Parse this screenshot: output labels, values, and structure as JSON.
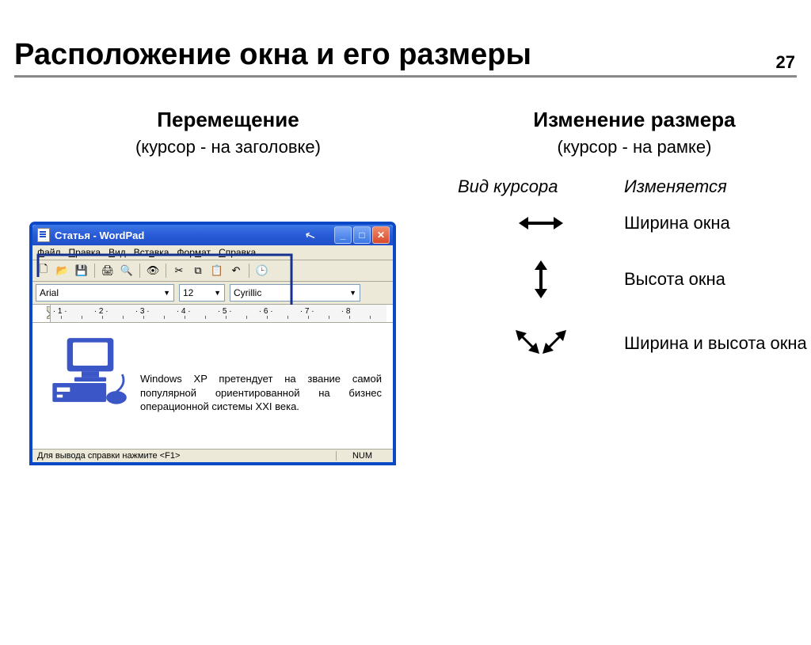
{
  "page_number": "27",
  "slide_title": "Расположение окна и его размеры",
  "left": {
    "heading": "Перемещение",
    "note": "(курсор - на заголовке)"
  },
  "right": {
    "heading": "Изменение размера",
    "note": "(курсор - на рамке)",
    "table": {
      "col1": "Вид курсора",
      "col2": "Изменяется",
      "rows": [
        {
          "label": "Ширина окна"
        },
        {
          "label": "Высота окна"
        },
        {
          "label": "Ширина и высота окна"
        }
      ]
    }
  },
  "wordpad": {
    "title": "Статья - WordPad",
    "menu": [
      "Файл",
      "Правка",
      "Вид",
      "Вставка",
      "Формат",
      "Справка"
    ],
    "format": {
      "font": "Arial",
      "size": "12",
      "script": "Cyrillic"
    },
    "ruler_marks": [
      "1",
      "2",
      "3",
      "4",
      "5",
      "6",
      "7",
      "8"
    ],
    "body_text": "Windows XP претендует на звание самой популярной ориентированной на бизнес операционной системы XXI века.",
    "status_left": "Для вывода справки нажмите <F1>",
    "status_right": "NUM"
  }
}
